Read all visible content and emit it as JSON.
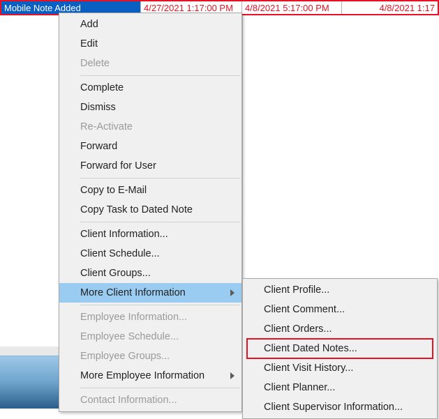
{
  "top_row": {
    "selected_label": "Mobile Note Added",
    "date1": "4/27/2021 1:17:00 PM",
    "date2": "4/8/2021 5:17:00 PM",
    "date3": "4/8/2021 1:17"
  },
  "menu": {
    "add": "Add",
    "edit": "Edit",
    "delete": "Delete",
    "complete": "Complete",
    "dismiss": "Dismiss",
    "reactivate": "Re-Activate",
    "forward": "Forward",
    "forward_user": "Forward for User",
    "copy_email": "Copy to E-Mail",
    "copy_task": "Copy Task to Dated Note",
    "client_info": "Client Information...",
    "client_schedule": "Client Schedule...",
    "client_groups": "Client Groups...",
    "more_client": "More Client Information",
    "emp_info": "Employee Information...",
    "emp_schedule": "Employee Schedule...",
    "emp_groups": "Employee Groups...",
    "more_emp": "More Employee Information",
    "contact_info": "Contact Information..."
  },
  "submenu": {
    "profile": "Client Profile...",
    "comment": "Client Comment...",
    "orders": "Client Orders...",
    "dated_notes": "Client Dated Notes...",
    "visit_history": "Client Visit History...",
    "planner": "Client Planner...",
    "supervisor": "Client Supervisor Information..."
  }
}
